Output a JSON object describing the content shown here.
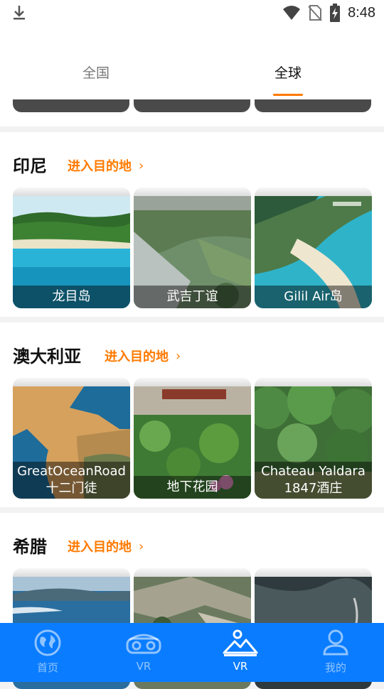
{
  "status_bar": {
    "time": "8:48",
    "icons": [
      "download-icon",
      "wifi-icon",
      "no-sim-icon",
      "battery-charging-icon"
    ]
  },
  "tabs": [
    {
      "label": "全国",
      "active": false
    },
    {
      "label": "全球",
      "active": true
    }
  ],
  "sections": [
    {
      "title": "印尼",
      "link": "进入目的地",
      "cards": [
        {
          "caption": "龙目岛"
        },
        {
          "caption": "武吉丁谊"
        },
        {
          "caption": "Gilil Air岛"
        }
      ]
    },
    {
      "title": "澳大利亚",
      "link": "进入目的地",
      "cards": [
        {
          "caption_line1": "GreatOceanRoad",
          "caption_line2": "十二门徒"
        },
        {
          "caption": "地下花园"
        },
        {
          "caption_line1": "Chateau Yaldara",
          "caption_line2": "1847酒庄"
        }
      ]
    },
    {
      "title": "希腊",
      "link": "进入目的地",
      "cards": [
        {
          "caption": ""
        },
        {
          "caption": ""
        },
        {
          "caption": ""
        }
      ]
    }
  ],
  "bottom_nav": [
    {
      "label": "首页",
      "icon": "globe-icon",
      "active": false
    },
    {
      "label": "VR",
      "icon": "vr-headset-icon",
      "active": false
    },
    {
      "label": "VR",
      "icon": "mountain-icon",
      "active": true
    },
    {
      "label": "我的",
      "icon": "user-icon",
      "active": false
    }
  ],
  "colors": {
    "accent": "#ff7a00",
    "nav_background": "#0a7cff",
    "page_background": "#f2f2f2"
  }
}
